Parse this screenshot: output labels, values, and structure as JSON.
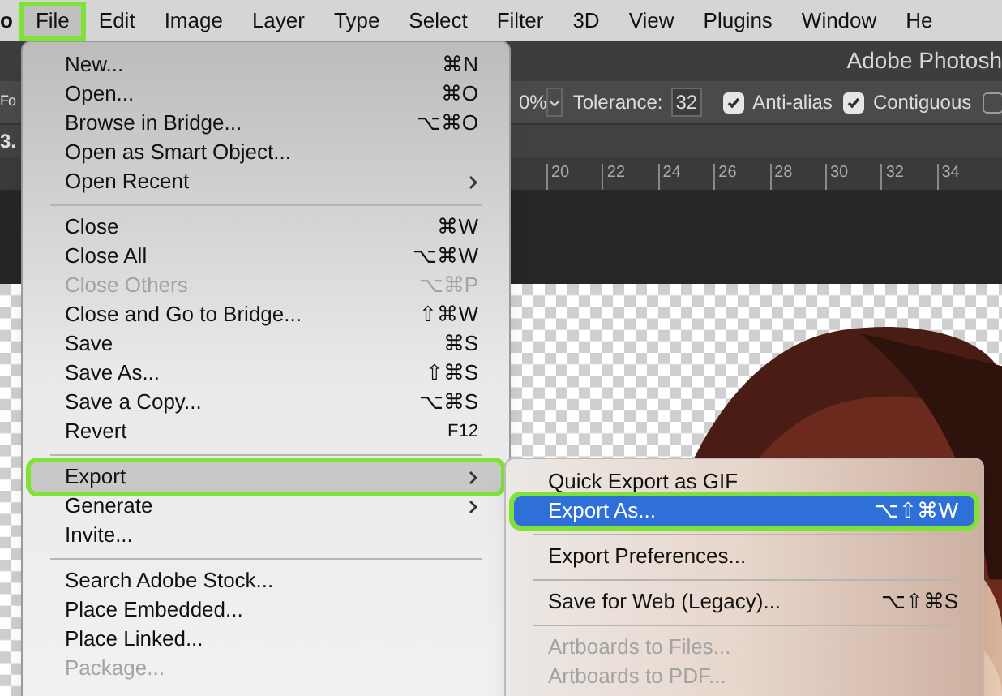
{
  "menu_bar": {
    "app_menu": "o",
    "items": [
      {
        "label": "File",
        "selected": true,
        "highlighted": true
      },
      {
        "label": "Edit",
        "selected": false,
        "highlighted": false
      },
      {
        "label": "Image",
        "selected": false,
        "highlighted": false
      },
      {
        "label": "Layer",
        "selected": false,
        "highlighted": false
      },
      {
        "label": "Type",
        "selected": false,
        "highlighted": false
      },
      {
        "label": "Select",
        "selected": false,
        "highlighted": false
      },
      {
        "label": "Filter",
        "selected": false,
        "highlighted": false
      },
      {
        "label": "3D",
        "selected": false,
        "highlighted": false
      },
      {
        "label": "View",
        "selected": false,
        "highlighted": false
      },
      {
        "label": "Plugins",
        "selected": false,
        "highlighted": false
      },
      {
        "label": "Window",
        "selected": false,
        "highlighted": false
      },
      {
        "label": "He",
        "selected": false,
        "highlighted": false
      }
    ]
  },
  "window": {
    "title": "Adobe Photosh"
  },
  "options_bar": {
    "left_label": "Fo",
    "opacity_value": "0%",
    "tolerance_label": "Tolerance:",
    "tolerance_value": "32",
    "checkboxes": [
      {
        "label": "Anti-alias",
        "checked": true
      },
      {
        "label": "Contiguous",
        "checked": true
      },
      {
        "checked": false
      }
    ]
  },
  "document_tab": {
    "label": "3."
  },
  "ruler": {
    "ticks": [
      "20",
      "22",
      "24",
      "26",
      "28",
      "30",
      "32",
      "34"
    ]
  },
  "file_menu": {
    "items": [
      {
        "kind": "item",
        "label": "New...",
        "shortcut": "⌘N",
        "disabled": false,
        "submenu": false,
        "selected": false,
        "highlighted": false
      },
      {
        "kind": "item",
        "label": "Open...",
        "shortcut": "⌘O",
        "disabled": false,
        "submenu": false,
        "selected": false,
        "highlighted": false
      },
      {
        "kind": "item",
        "label": "Browse in Bridge...",
        "shortcut": "⌥⌘O",
        "disabled": false,
        "submenu": false,
        "selected": false,
        "highlighted": false
      },
      {
        "kind": "item",
        "label": "Open as Smart Object...",
        "disabled": false,
        "submenu": false,
        "selected": false,
        "highlighted": false
      },
      {
        "kind": "item",
        "label": "Open Recent",
        "disabled": false,
        "submenu": true,
        "selected": false,
        "highlighted": false
      },
      {
        "kind": "separator"
      },
      {
        "kind": "item",
        "label": "Close",
        "shortcut": "⌘W",
        "disabled": false,
        "submenu": false,
        "selected": false,
        "highlighted": false
      },
      {
        "kind": "item",
        "label": "Close All",
        "shortcut": "⌥⌘W",
        "disabled": false,
        "submenu": false,
        "selected": false,
        "highlighted": false
      },
      {
        "kind": "item",
        "label": "Close Others",
        "shortcut": "⌥⌘P",
        "disabled": true,
        "submenu": false,
        "selected": false,
        "highlighted": false
      },
      {
        "kind": "item",
        "label": "Close and Go to Bridge...",
        "shortcut": "⇧⌘W",
        "disabled": false,
        "submenu": false,
        "selected": false,
        "highlighted": false
      },
      {
        "kind": "item",
        "label": "Save",
        "shortcut": "⌘S",
        "disabled": false,
        "submenu": false,
        "selected": false,
        "highlighted": false
      },
      {
        "kind": "item",
        "label": "Save As...",
        "shortcut": "⇧⌘S",
        "disabled": false,
        "submenu": false,
        "selected": false,
        "highlighted": false
      },
      {
        "kind": "item",
        "label": "Save a Copy...",
        "shortcut": "⌥⌘S",
        "disabled": false,
        "submenu": false,
        "selected": false,
        "highlighted": false
      },
      {
        "kind": "item",
        "label": "Revert",
        "shortcut": "F12",
        "disabled": false,
        "submenu": false,
        "selected": false,
        "highlighted": false
      },
      {
        "kind": "separator"
      },
      {
        "kind": "item",
        "label": "Export",
        "disabled": false,
        "submenu": true,
        "selected": true,
        "highlighted": true
      },
      {
        "kind": "item",
        "label": "Generate",
        "disabled": false,
        "submenu": true,
        "selected": false,
        "highlighted": false
      },
      {
        "kind": "item",
        "label": "Invite...",
        "disabled": false,
        "submenu": false,
        "selected": false,
        "highlighted": false
      },
      {
        "kind": "separator"
      },
      {
        "kind": "item",
        "label": "Search Adobe Stock...",
        "disabled": false,
        "submenu": false,
        "selected": false,
        "highlighted": false
      },
      {
        "kind": "item",
        "label": "Place Embedded...",
        "disabled": false,
        "submenu": false,
        "selected": false,
        "highlighted": false
      },
      {
        "kind": "item",
        "label": "Place Linked...",
        "disabled": false,
        "submenu": false,
        "selected": false,
        "highlighted": false
      },
      {
        "kind": "item",
        "label": "Package...",
        "disabled": true,
        "submenu": false,
        "selected": false,
        "highlighted": false
      }
    ]
  },
  "export_submenu": {
    "items": [
      {
        "kind": "item",
        "label": "Quick Export as GIF",
        "disabled": false,
        "selected": false,
        "highlighted": false
      },
      {
        "kind": "item",
        "label": "Export As...",
        "shortcut": "⌥⇧⌘W",
        "disabled": false,
        "selected": true,
        "highlighted": true
      },
      {
        "kind": "separator"
      },
      {
        "kind": "item",
        "label": "Export Preferences...",
        "disabled": false,
        "selected": false,
        "highlighted": false
      },
      {
        "kind": "separator"
      },
      {
        "kind": "item",
        "label": "Save for Web (Legacy)...",
        "shortcut": "⌥⇧⌘S",
        "disabled": false,
        "selected": false,
        "highlighted": false
      },
      {
        "kind": "separator"
      },
      {
        "kind": "item",
        "label": "Artboards to Files...",
        "disabled": true,
        "selected": false,
        "highlighted": false
      },
      {
        "kind": "item",
        "label": "Artboards to PDF...",
        "disabled": true,
        "selected": false,
        "highlighted": false
      }
    ]
  }
}
